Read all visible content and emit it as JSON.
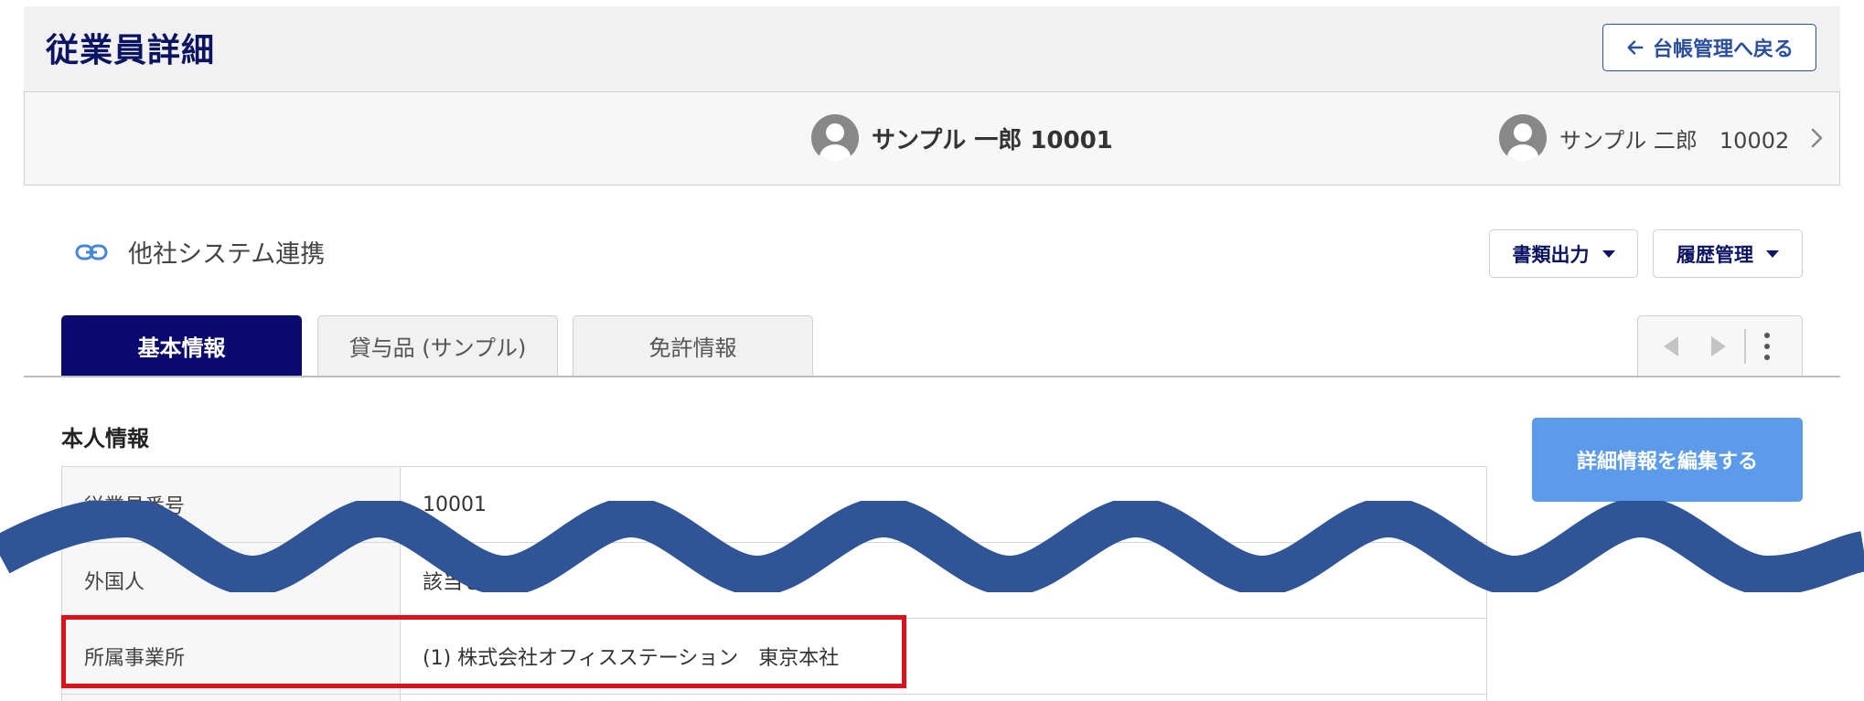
{
  "header": {
    "title": "従業員詳細",
    "back_label": "台帳管理へ戻る"
  },
  "employee_nav": {
    "current": "サンプル 一郎 10001",
    "next": "サンプル 二郎　10002"
  },
  "integration": {
    "label": "他社システム連携"
  },
  "actions": {
    "documents": "書類出力",
    "history": "履歴管理"
  },
  "tabs": [
    {
      "label": "基本情報",
      "active": true
    },
    {
      "label": "貸与品 (サンプル)",
      "active": false
    },
    {
      "label": "免許情報",
      "active": false
    }
  ],
  "section": {
    "title": "本人情報",
    "edit_label": "詳細情報を編集する"
  },
  "table": {
    "rows": [
      {
        "key": "従業員番号",
        "value": "10001"
      },
      {
        "key": "外国人",
        "value": "該当しない"
      },
      {
        "key": "所属事業所",
        "value": "(1) 株式会社オフィスステーション　東京本社"
      }
    ]
  },
  "colors": {
    "brand_navy": "#0a0a6e",
    "title_navy": "#0a1463",
    "edit_button": "#5b9bea",
    "wave_overlay": "#2f5597",
    "highlight_border": "#e0101a"
  },
  "icons": [
    "arrow-left-icon",
    "avatar-icon",
    "chevron-right-icon",
    "link-icon",
    "caret-down-icon",
    "prev-icon",
    "next-icon",
    "more-vertical-icon"
  ]
}
